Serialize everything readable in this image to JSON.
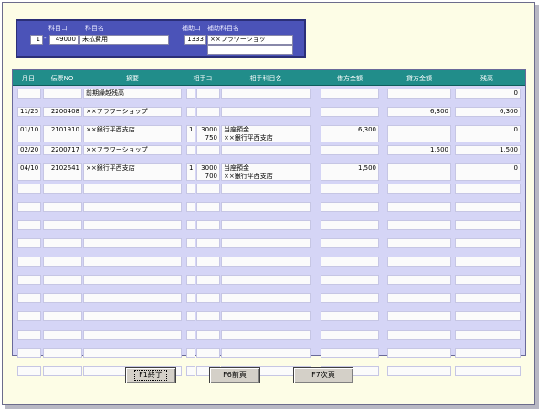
{
  "header": {
    "account_code_label": "科目コ",
    "account_name_label": "科目名",
    "sub_code_label": "補助コ",
    "sub_name_label": "補助科目名",
    "account_prefix": "1",
    "account_code": "49000",
    "account_name": "未払費用",
    "sub_code": "1333",
    "sub_name": "××フラワーショッ",
    "sub_name_extra": ""
  },
  "columns": [
    "月日",
    "伝票NO",
    "摘要",
    "相手コ",
    "相手科目名",
    "借方金額",
    "貸方金額",
    "残高"
  ],
  "rows": [
    {
      "date": "",
      "voucher": "",
      "summary": "前期繰越残高",
      "code1": "",
      "code2": "",
      "partner": "",
      "debit": "",
      "credit": "",
      "balance": "0"
    },
    {
      "date": "11/25",
      "voucher": "2200408",
      "summary": "××フラワーショップ",
      "code1": "",
      "code2": "",
      "partner": "",
      "debit": "",
      "credit": "6,300",
      "balance": "6,300"
    },
    {
      "date": "01/10",
      "voucher": "2101910",
      "summary": "××銀行平西支店",
      "code1": "1",
      "code2": "3000",
      "code2b": "750",
      "partner": "当座預金",
      "partner2": "××銀行平西支店",
      "debit": "6,300",
      "credit": "",
      "balance": "0"
    },
    {
      "date": "02/20",
      "voucher": "2200717",
      "summary": "××フラワーショップ",
      "code1": "",
      "code2": "",
      "partner": "",
      "debit": "",
      "credit": "1,500",
      "balance": "1,500"
    },
    {
      "date": "04/10",
      "voucher": "2102641",
      "summary": "××銀行平西支店",
      "code1": "1",
      "code2": "3000",
      "code2b": "700",
      "partner": "当座預金",
      "partner2": "××銀行平西支店",
      "debit": "1,500",
      "credit": "",
      "balance": "0"
    },
    {
      "date": "",
      "voucher": "",
      "summary": "",
      "code1": "",
      "code2": "",
      "partner": "",
      "debit": "",
      "credit": "",
      "balance": ""
    },
    {
      "date": "",
      "voucher": "",
      "summary": "",
      "code1": "",
      "code2": "",
      "partner": "",
      "debit": "",
      "credit": "",
      "balance": ""
    },
    {
      "date": "",
      "voucher": "",
      "summary": "",
      "code1": "",
      "code2": "",
      "partner": "",
      "debit": "",
      "credit": "",
      "balance": ""
    },
    {
      "date": "",
      "voucher": "",
      "summary": "",
      "code1": "",
      "code2": "",
      "partner": "",
      "debit": "",
      "credit": "",
      "balance": ""
    },
    {
      "date": "",
      "voucher": "",
      "summary": "",
      "code1": "",
      "code2": "",
      "partner": "",
      "debit": "",
      "credit": "",
      "balance": ""
    },
    {
      "date": "",
      "voucher": "",
      "summary": "",
      "code1": "",
      "code2": "",
      "partner": "",
      "debit": "",
      "credit": "",
      "balance": ""
    },
    {
      "date": "",
      "voucher": "",
      "summary": "",
      "code1": "",
      "code2": "",
      "partner": "",
      "debit": "",
      "credit": "",
      "balance": ""
    },
    {
      "date": "",
      "voucher": "",
      "summary": "",
      "code1": "",
      "code2": "",
      "partner": "",
      "debit": "",
      "credit": "",
      "balance": ""
    },
    {
      "date": "",
      "voucher": "",
      "summary": "",
      "code1": "",
      "code2": "",
      "partner": "",
      "debit": "",
      "credit": "",
      "balance": ""
    },
    {
      "date": "",
      "voucher": "",
      "summary": "",
      "code1": "",
      "code2": "",
      "partner": "",
      "debit": "",
      "credit": "",
      "balance": ""
    },
    {
      "date": "",
      "voucher": "",
      "summary": "",
      "code1": "",
      "code2": "",
      "partner": "",
      "debit": "",
      "credit": "",
      "balance": ""
    }
  ],
  "buttons": {
    "f1": "F1終了",
    "f6": "F6前頁",
    "f7": "F7次頁"
  }
}
